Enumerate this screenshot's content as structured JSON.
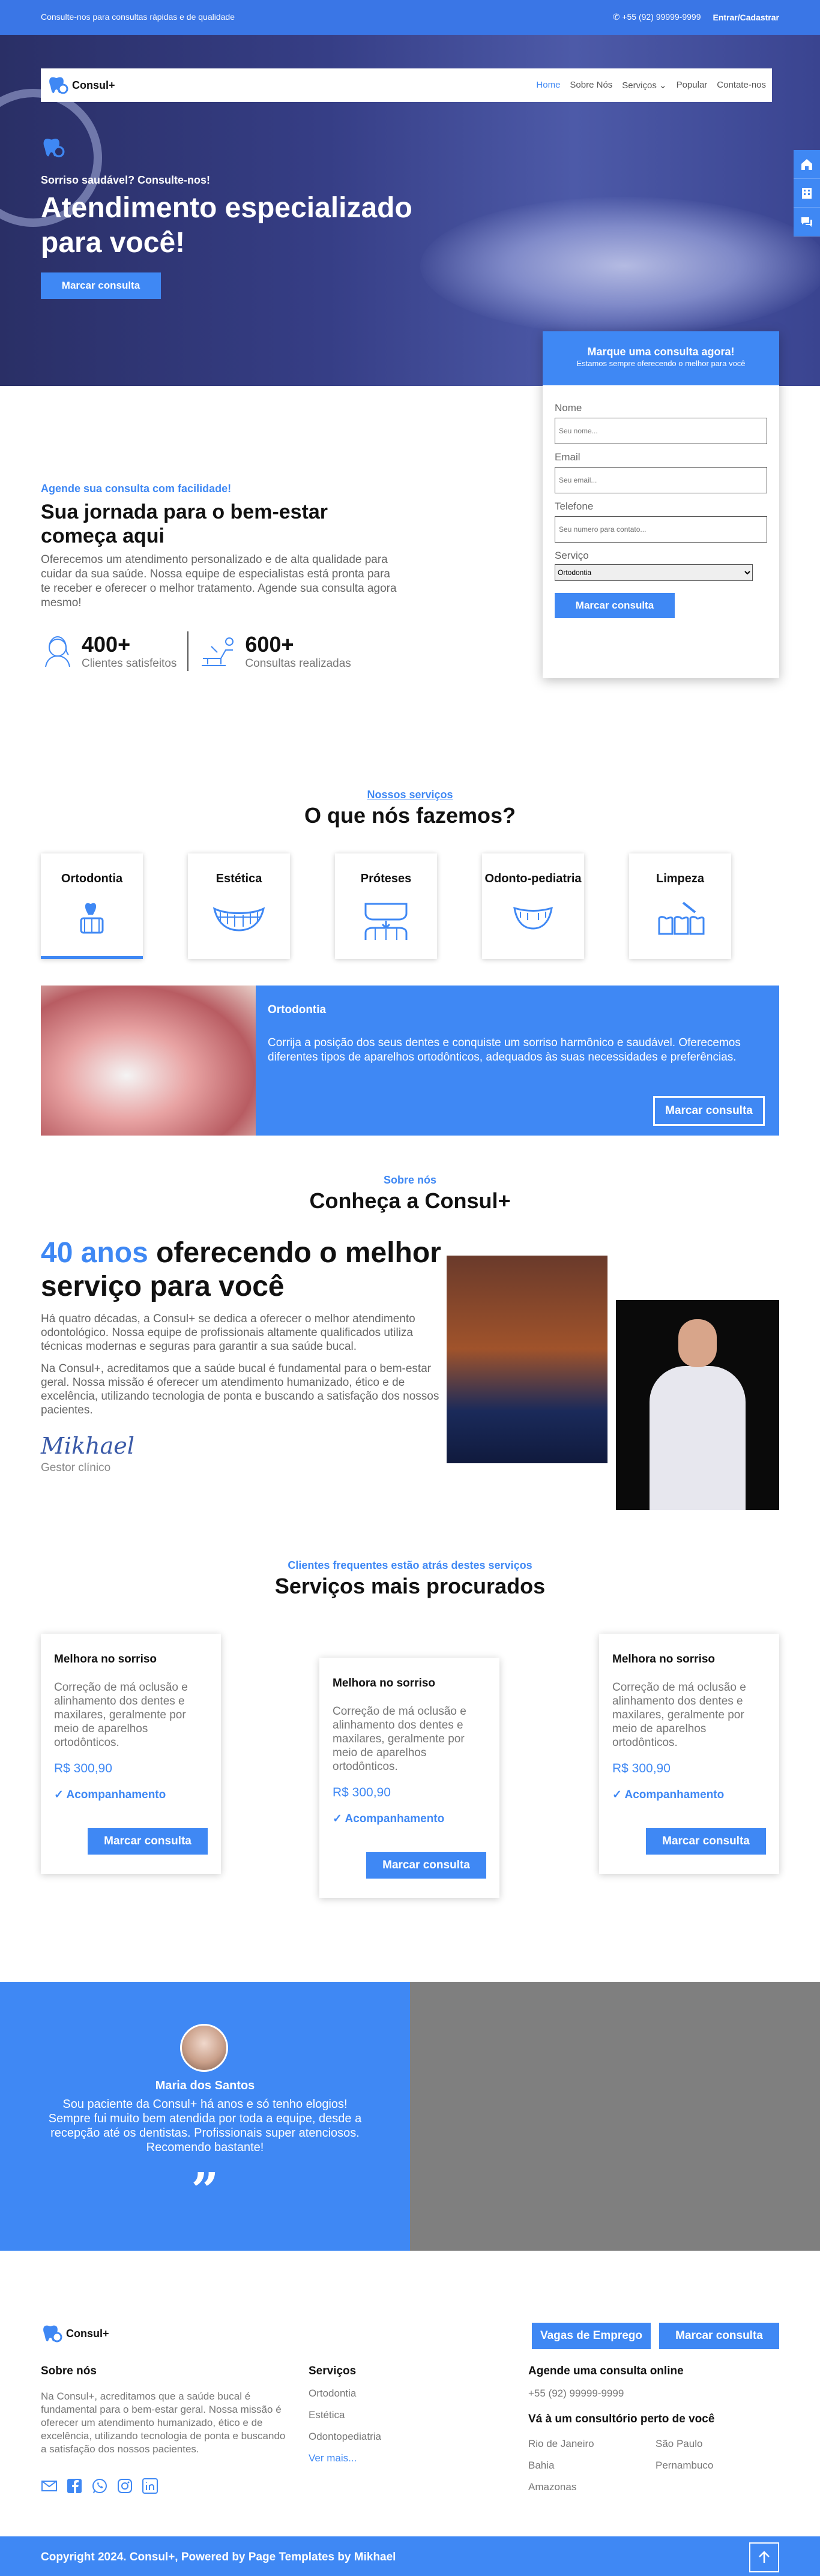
{
  "topbar": {
    "tagline": "Consulte-nos para consultas rápidas e de qualidade",
    "phone": "+55 (92) 99999-9999",
    "login": "Entrar/Cadastrar"
  },
  "nav": {
    "brand": "Consul+",
    "links": [
      "Home",
      "Sobre Nós",
      "Serviços",
      "Popular",
      "Contate-nos"
    ]
  },
  "hero": {
    "subtitle": "Sorriso saudável? Consulte-nos!",
    "title": "Atendimento especializado para você!",
    "cta": "Marcar consulta"
  },
  "form": {
    "title": "Marque uma consulta agora!",
    "subtitle": "Estamos sempre oferecendo o melhor para você",
    "name_label": "Nome",
    "name_ph": "Seu nome...",
    "email_label": "Email",
    "email_ph": "Seu email...",
    "phone_label": "Telefone",
    "phone_ph": "Seu numero para contato...",
    "service_label": "Serviço",
    "service_value": "Ortodontia",
    "submit": "Marcar consulta"
  },
  "intro": {
    "kicker": "Agende sua consulta com facilidade!",
    "title": "Sua jornada para o bem-estar começa aqui",
    "text": "Oferecemos um atendimento personalizado e de alta qualidade para cuidar da sua saúde. Nossa equipe de especialistas está pronta para te receber e oferecer o melhor tratamento. Agende sua consulta agora mesmo!",
    "stats": [
      {
        "number": "400+",
        "label": "Clientes satisfeitos"
      },
      {
        "number": "600+",
        "label": "Consultas realizadas"
      }
    ]
  },
  "services": {
    "kicker": "Nossos serviços",
    "title": "O que nós fazemos?",
    "tabs": [
      "Ortodontia",
      "Estética",
      "Próteses",
      "Odonto-pediatria",
      "Limpeza"
    ],
    "detail": {
      "title": "Ortodontia",
      "text": "Corrija a posição dos seus dentes e conquiste um sorriso harmônico e saudável. Oferecemos diferentes tipos de aparelhos ortodônticos, adequados às suas necessidades e preferências.",
      "button": "Marcar consulta"
    }
  },
  "about": {
    "kicker": "Sobre nós",
    "title": "Conheça a Consul+",
    "headline_accent": "40 anos",
    "headline_rest": "oferecendo o melhor serviço para você",
    "p1": "Há quatro décadas, a Consul+ se dedica a oferecer o melhor atendimento odontológico. Nossa equipe de profissionais altamente qualificados utiliza técnicas modernas e seguras para garantir a sua saúde bucal.",
    "p2": "Na Consul+, acreditamos que a saúde bucal é fundamental para o bem-estar geral. Nossa missão é oferecer um atendimento humanizado, ético e de excelência, utilizando tecnologia de ponta e buscando a satisfação dos nossos pacientes.",
    "signature": "Mikhael",
    "role": "Gestor clínico"
  },
  "popular": {
    "kicker": "Clientes frequentes estão atrás destes serviços",
    "title": "Serviços mais procurados",
    "cards": [
      {
        "title": "Melhora no sorriso",
        "text": "Correção de má oclusão e alinhamento dos dentes e maxilares, geralmente por meio de aparelhos ortodônticos.",
        "price": "R$ 300,90",
        "feature": "Acompanhamento",
        "button": "Marcar consulta"
      },
      {
        "title": "Melhora no sorriso",
        "text": "Correção de má oclusão e alinhamento dos dentes e maxilares, geralmente por meio de aparelhos ortodônticos.",
        "price": "R$ 300,90",
        "feature": "Acompanhamento",
        "button": "Marcar consulta"
      },
      {
        "title": "Melhora no sorriso",
        "text": "Correção de má oclusão e alinhamento dos dentes e maxilares, geralmente por meio de aparelhos ortodônticos.",
        "price": "R$ 300,90",
        "feature": "Acompanhamento",
        "button": "Marcar consulta"
      }
    ]
  },
  "testimonial": {
    "name": "Maria dos Santos",
    "text": "Sou paciente da Consul+ há anos e só tenho elogios! Sempre fui muito bem atendida por toda a equipe, desde a recepção até os dentistas. Profissionais super atenciosos. Recomendo bastante!"
  },
  "footer": {
    "brand": "Consul+",
    "jobs": "Vagas de Emprego",
    "book": "Marcar consulta",
    "about_title": "Sobre nós",
    "about_text": "Na Consul+, acreditamos que a saúde bucal é fundamental para o bem-estar geral. Nossa missão é oferecer um atendimento humanizado, ético e de excelência, utilizando tecnologia de ponta e buscando a satisfação dos nossos pacientes.",
    "services_title": "Serviços",
    "services": [
      "Ortodontia",
      "Estética",
      "Odontopediatria"
    ],
    "more": "Ver mais...",
    "online_title": "Agende uma consulta online",
    "phone": "+55 (92) 99999-9999",
    "near_title": "Vá à um consultório perto de você",
    "cities": [
      "Rio de Janeiro",
      "São Paulo",
      "Bahia",
      "Pernambuco",
      "Amazonas"
    ],
    "copyright": "Copyright 2024. Consul+, Powered by Page Templates by Mikhael"
  },
  "colors": {
    "accent": "#3f88f4",
    "topbar": "#3a76e6"
  },
  "icons": [
    "tooth-logo-icon",
    "phone-icon",
    "home-icon",
    "building-icon",
    "chat-icon",
    "check-icon",
    "quote-icon",
    "mail-icon",
    "facebook-icon",
    "whatsapp-icon",
    "instagram-icon",
    "linkedin-icon",
    "arrow-up-icon"
  ]
}
